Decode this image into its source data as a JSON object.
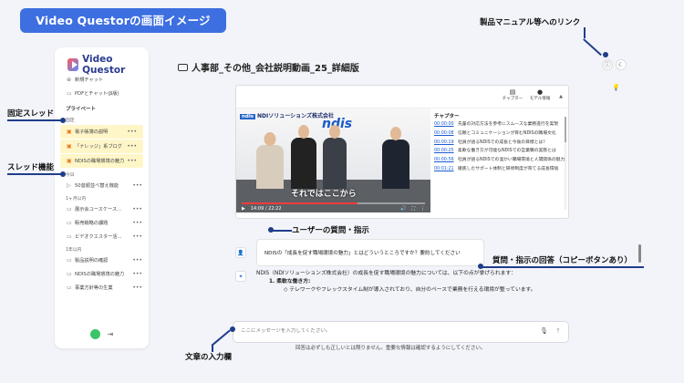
{
  "banner": "Video Questorの画面イメージ",
  "annotations": {
    "manual_link": "製品マニュアル等へのリンク",
    "pinned_thread": "固定スレッド",
    "thread_function": "スレッド機能",
    "user_question": "ユーザーの質問・指示",
    "answer": "質問・指示の回答（コピーボタンあり）",
    "text_input": "文章の入力欄"
  },
  "sidebar": {
    "brand": "Video Questor",
    "new_chat": "新規チャット",
    "pdf_chat": "PDFとチャット(β版)",
    "private_label": "プライベート",
    "pinned_label": "固定",
    "pinned_items": [
      "電子帳簿の説明",
      "「ナレッジ」系ブログ",
      "NDISの職場環境の魅力"
    ],
    "today_label": "今日",
    "today_items": [
      "50音順並べ替え機能"
    ],
    "month_label": "1ヶ月以内",
    "month_items": [
      "展示会ユースケース...",
      "販売戦略の課題",
      "ビデオクエスター活..."
    ],
    "year_label": "1年以内",
    "year_items": [
      "製品説明の確認",
      "NDISの職場環境の魅力",
      "事業方針等の生業"
    ]
  },
  "main": {
    "title": "人事部_その他_会社説明動画_25_詳細版",
    "toolbar": {
      "chapter_btn": "チャプター",
      "model_info_btn": "モデル情報"
    },
    "video": {
      "slide_company": "NDIソリューションズ株式会社",
      "slide_badge": "ndis",
      "slide_logo": "ndis",
      "caption": "それではここから",
      "time": "14:09 / 22:22",
      "progress": 0.63
    },
    "chapters_title": "チャプター",
    "chapters": [
      {
        "time": "00:00:00",
        "text": "先輩の対応方法を参考にスムーズな業務進行を実現"
      },
      {
        "time": "00:00:08",
        "text": "信頼とコミュニケーションが育むNDISの職場文化"
      },
      {
        "time": "00:00:19",
        "text": "社員が語るNDISでの成長と今後の目標とは？"
      },
      {
        "time": "00:00:25",
        "text": "柔軟な働き方が可能なNDISでの営業職の実態とは"
      },
      {
        "time": "00:00:56",
        "text": "社員が語るNDISでの温かい職場環境と人間関係の魅力"
      },
      {
        "time": "00:01:21",
        "text": "徹底したサポート体制と研修制度が育てる成長環境"
      }
    ],
    "user_message": "NDISの「成長を促す職場環境の魅力」とはどういうところですか？要約してください",
    "answer": {
      "intro": "NDIS（NDIソリューションズ株式会社）の成長を促す職場環境の魅力については、以下の点が挙げられます：",
      "heading": "1. 柔軟な働き方:",
      "bullet": "テレワークやフレックスタイム制が導入されており、自分のペースで業務を行える環境が整っています。"
    },
    "input_placeholder": "ここにメッセージを入力してください。",
    "disclaimer": "回答は必ずしも正しいとは限りません。重要な情報は確認するようにしてください。"
  }
}
